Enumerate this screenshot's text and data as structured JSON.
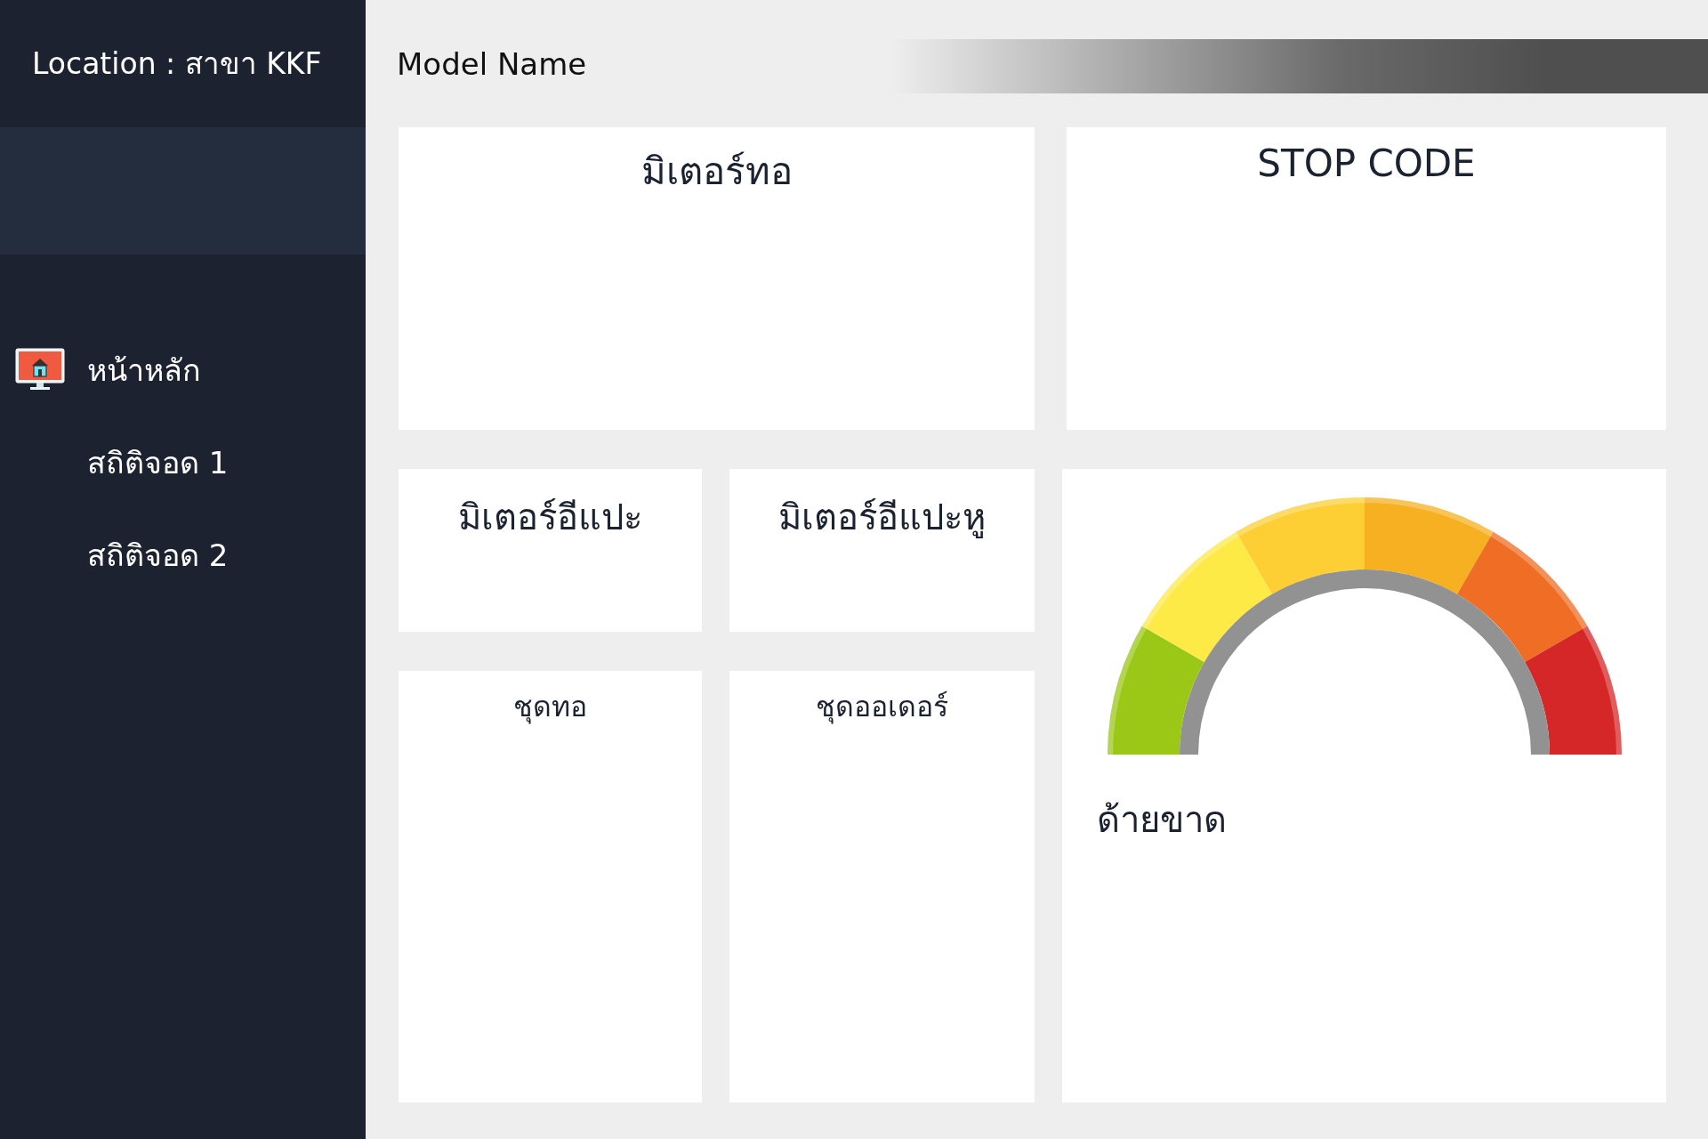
{
  "sidebar": {
    "location": "Location : สาขา KKF",
    "items": [
      {
        "label": "หน้าหลัก",
        "kind": "icon"
      },
      {
        "label": "สถิติจอด 1",
        "kind": "plain"
      },
      {
        "label": "สถิติจอด 2",
        "kind": "plain"
      }
    ]
  },
  "header": {
    "model_name": "Model Name"
  },
  "panels": [
    {
      "title": "มิเตอร์ทอ",
      "kind": "large"
    },
    {
      "title": "STOP CODE",
      "kind": "large"
    },
    {
      "title": "มิเตอร์อีแปะ",
      "kind": "small"
    },
    {
      "title": "มิเตอร์อีแปะหู",
      "kind": "small"
    },
    {
      "title": "ด้ายขาด",
      "kind": "gauge"
    },
    {
      "title": "ชุดทอ",
      "kind": "tall"
    },
    {
      "title": "ชุดออเดอร์",
      "kind": "tall"
    }
  ]
}
